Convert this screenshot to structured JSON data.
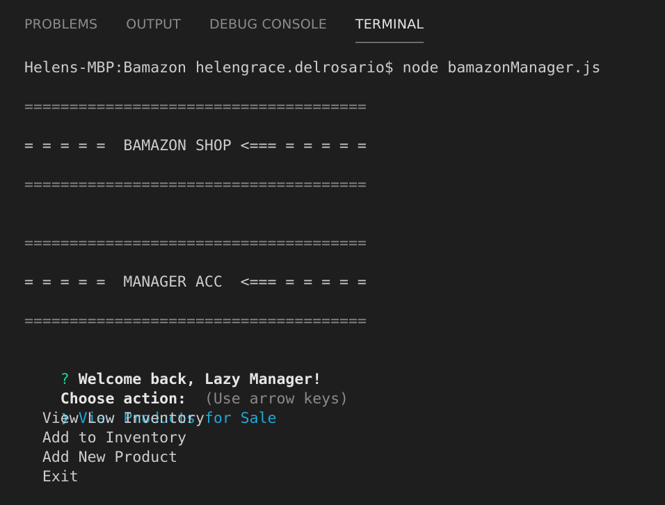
{
  "panel": {
    "tabs": [
      {
        "label": "PROBLEMS",
        "active": false
      },
      {
        "label": "OUTPUT",
        "active": false
      },
      {
        "label": "DEBUG CONSOLE",
        "active": false
      },
      {
        "label": "TERMINAL",
        "active": true
      }
    ]
  },
  "terminal": {
    "prompt_line": "Helens-MBP:Bamazon helengrace.delrosario$ node bamazonManager.js",
    "banner": {
      "rule": "======================================",
      "shop_title": "= = = = =  BAMAZON SHOP <=== = = = = =",
      "manager_title": "= = = = =  MANAGER ACC  <=== = = = = ="
    },
    "question": {
      "mark": "?",
      "message": "Welcome back, Lazy Manager!",
      "choose_label": "Choose action:",
      "hint": "(Use arrow keys)"
    },
    "menu": {
      "pointer": "❯",
      "options": [
        {
          "label": "View Products for Sale",
          "selected": true
        },
        {
          "label": "View Low Inventory",
          "selected": false
        },
        {
          "label": "Add to Inventory",
          "selected": false
        },
        {
          "label": "Add New Product",
          "selected": false
        },
        {
          "label": "Exit",
          "selected": false
        }
      ]
    }
  },
  "colors": {
    "background": "#1e1e1e",
    "selected_option": "#1fa8d6",
    "question_mark": "#23d18b"
  }
}
